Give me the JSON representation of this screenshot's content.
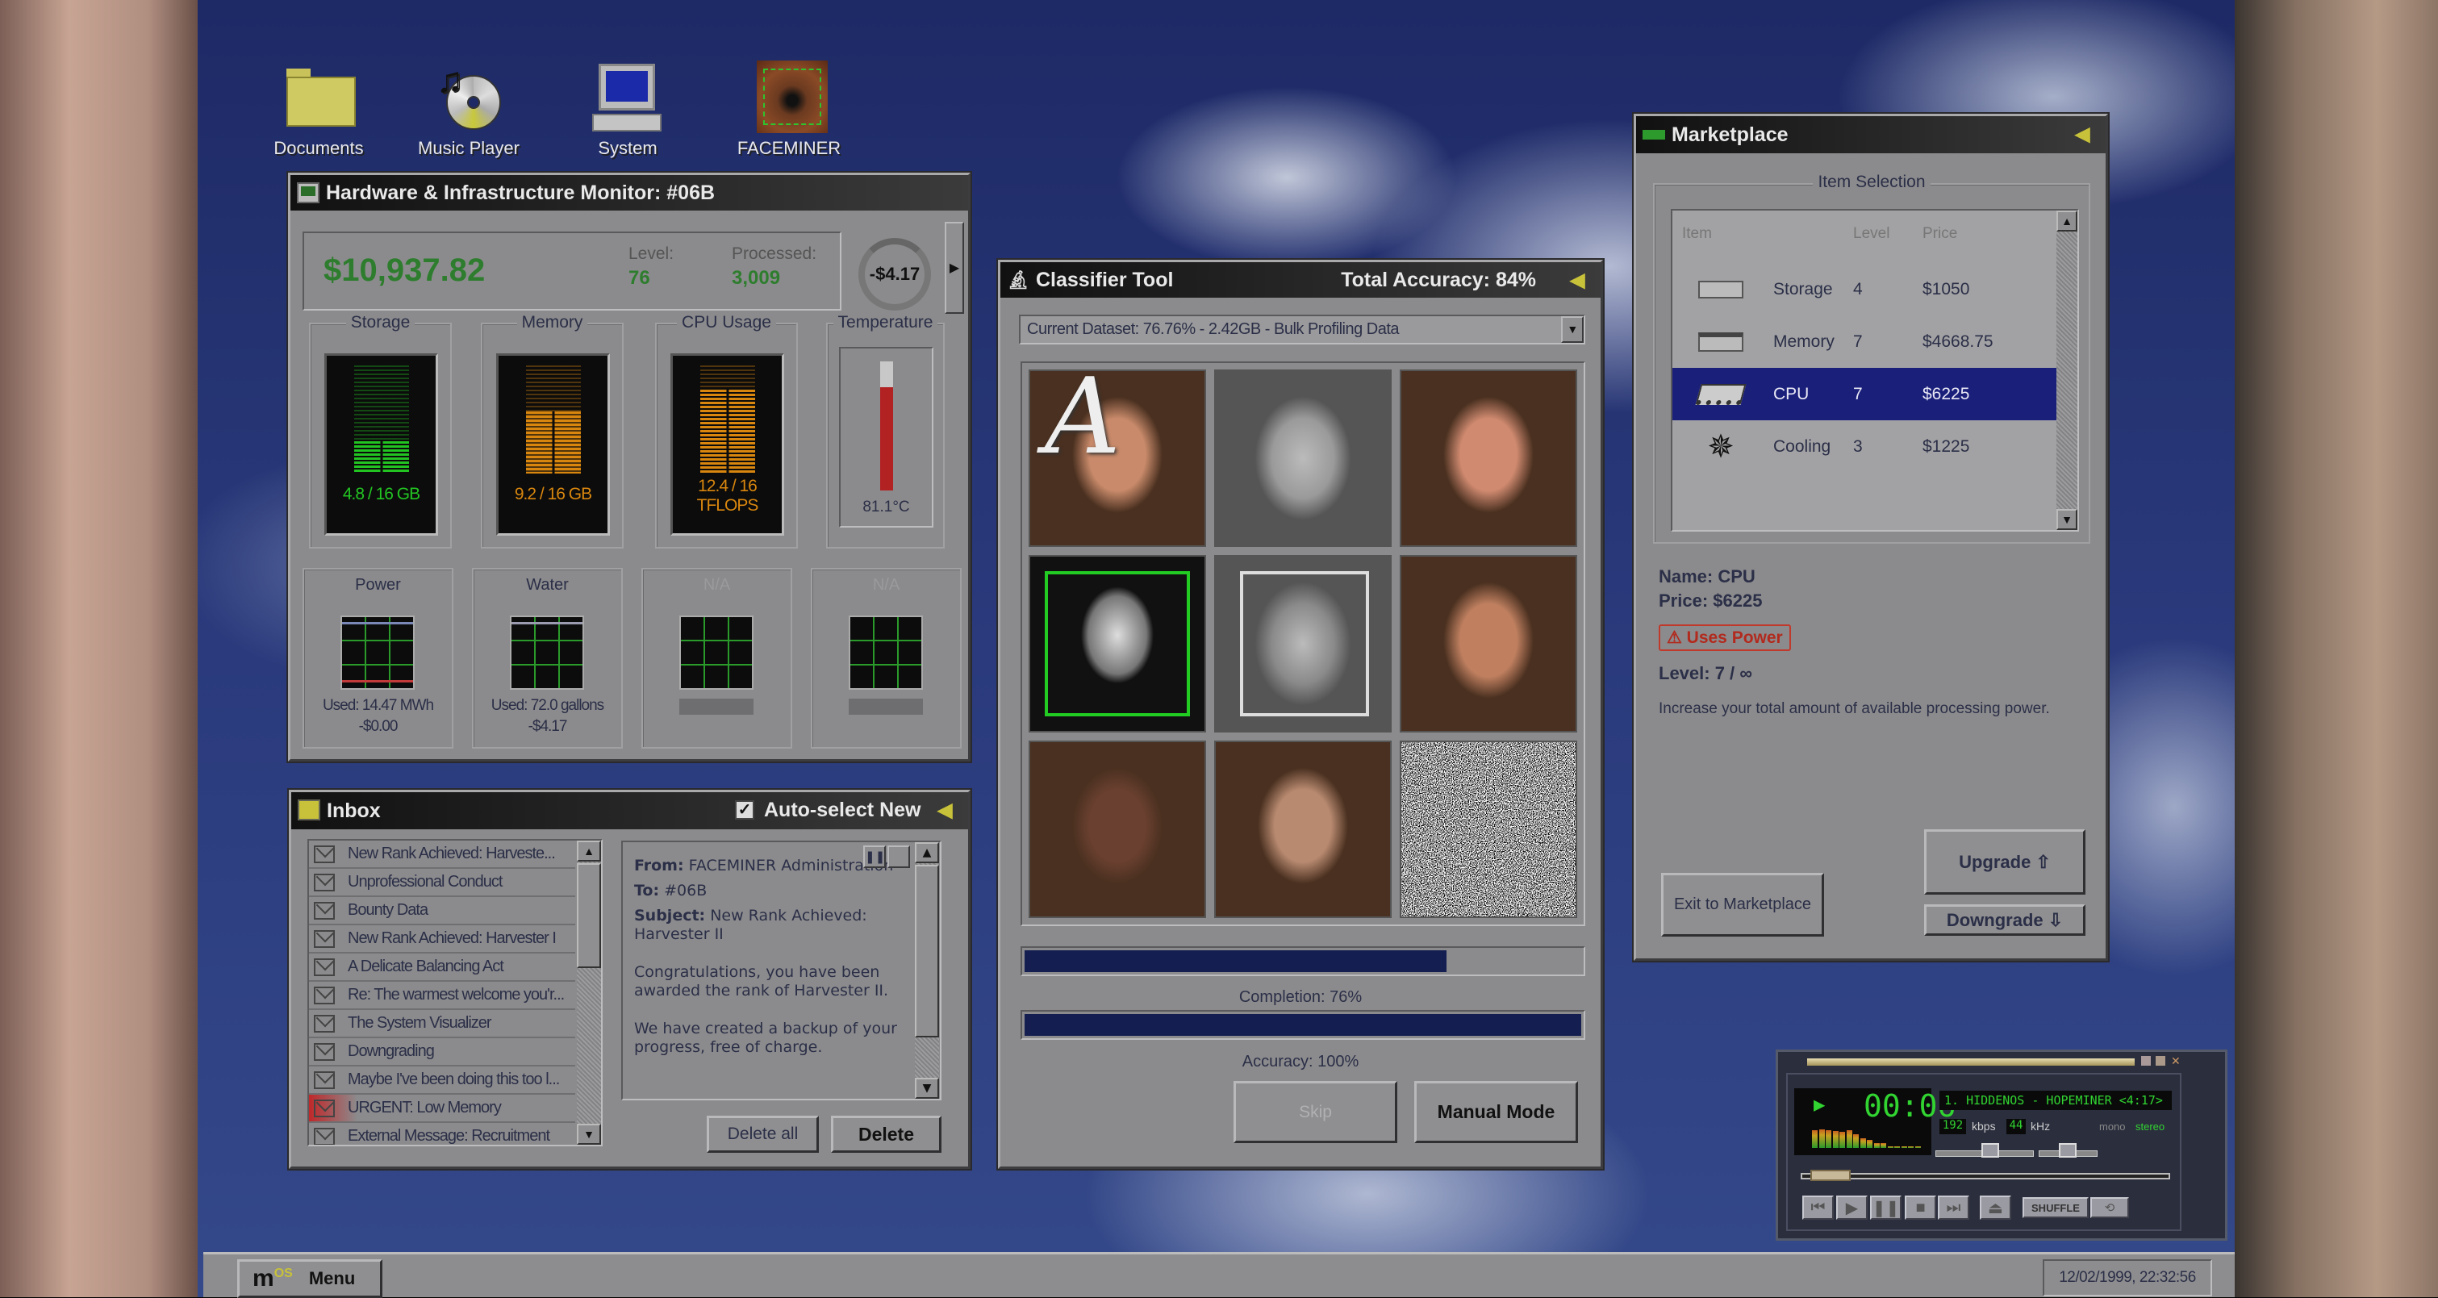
{
  "desktop_icons": [
    {
      "label": "Documents",
      "icon": "folder-icon"
    },
    {
      "label": "Music Player",
      "icon": "cd-music-icon"
    },
    {
      "label": "System",
      "icon": "computer-icon"
    },
    {
      "label": "FACEMINER",
      "icon": "eye-scan-icon"
    }
  ],
  "hardware_monitor": {
    "title": "Hardware & Infrastructure Monitor: #06B",
    "balance": "$10,937.82",
    "level_label": "Level:",
    "level": "76",
    "processed_label": "Processed:",
    "processed": "3,009",
    "rate": "-$4.17",
    "meters": [
      {
        "label": "Storage",
        "value": "4.8 / 16 GB",
        "fill": 0.3,
        "color": "#22c422"
      },
      {
        "label": "Memory",
        "value": "9.2 / 16 GB",
        "fill": 0.575,
        "color": "#d8860e"
      },
      {
        "label": "CPU Usage",
        "value": "12.4 / 16 TFLOPS",
        "fill": 0.775,
        "color": "#d8860e"
      }
    ],
    "temperature": {
      "label": "Temperature",
      "value": "81.1°C",
      "fill": 0.8,
      "color": "#b22222"
    },
    "resources": [
      {
        "label": "Power",
        "used": "Used: 14.47 MWh",
        "cost": "-$0.00"
      },
      {
        "label": "Water",
        "used": "Used: 72.0 gallons",
        "cost": "-$4.17"
      },
      {
        "label": "N/A",
        "used": "",
        "cost": ""
      },
      {
        "label": "N/A",
        "used": "",
        "cost": ""
      }
    ]
  },
  "inbox": {
    "title": "Inbox",
    "auto_select_label": "Auto-select New",
    "auto_select_checked": true,
    "messages": [
      {
        "subject": "New Rank Achieved: Harveste...",
        "urgent": false
      },
      {
        "subject": "Unprofessional Conduct",
        "urgent": false
      },
      {
        "subject": "Bounty Data",
        "urgent": false
      },
      {
        "subject": "New Rank Achieved: Harvester I",
        "urgent": false
      },
      {
        "subject": "A Delicate Balancing Act",
        "urgent": false
      },
      {
        "subject": "Re: The warmest welcome you'r...",
        "urgent": false
      },
      {
        "subject": "The System Visualizer",
        "urgent": false
      },
      {
        "subject": "Downgrading",
        "urgent": false
      },
      {
        "subject": "Maybe I've been doing this too l...",
        "urgent": false
      },
      {
        "subject": "URGENT: Low Memory",
        "urgent": true
      },
      {
        "subject": "External Message: Recruitment",
        "urgent": false
      }
    ],
    "preview": {
      "from_label": "From:",
      "from": "FACEMINER Administration",
      "to_label": "To:",
      "to": "#06B",
      "subject_label": "Subject:",
      "subject": "New Rank Achieved: Harvester II",
      "body1": "Congratulations, you have been awarded the rank of Harvester II.",
      "body2": "We have created a backup of your progress, free of charge."
    },
    "delete_all_label": "Delete all",
    "delete_label": "Delete"
  },
  "classifier": {
    "title": "Classifier Tool",
    "total_accuracy": "Total Accuracy: 84%",
    "dataset": "Current Dataset: 76.76% - 2.42GB - Bulk Profiling Data",
    "faces": [
      {
        "kind": "color",
        "tint": "#c88a6a",
        "overlay_letter": "A"
      },
      {
        "kind": "gray",
        "tint": "#9a9a9a"
      },
      {
        "kind": "color",
        "tint": "#d08a70"
      },
      {
        "kind": "bw",
        "tint": "#ffffff",
        "box": "#22cc22"
      },
      {
        "kind": "gray",
        "tint": "#8a8a8a",
        "box": "#dddddd"
      },
      {
        "kind": "color",
        "tint": "#c08060"
      },
      {
        "kind": "color",
        "tint": "#6a4030"
      },
      {
        "kind": "color",
        "tint": "#b88a70"
      },
      {
        "kind": "noise",
        "tint": "#808080"
      }
    ],
    "completion": 0.76,
    "completion_label": "Completion: 76%",
    "accuracy": 1.0,
    "accuracy_label": "Accuracy: 100%",
    "skip_label": "Skip",
    "manual_label": "Manual Mode"
  },
  "marketplace": {
    "title": "Marketplace",
    "group_label": "Item Selection",
    "columns": [
      "Item",
      "Level",
      "Price"
    ],
    "items": [
      {
        "name": "Storage",
        "level": "4",
        "price": "$1050",
        "icon": "hard-drive-icon",
        "selected": false
      },
      {
        "name": "Memory",
        "level": "7",
        "price": "$4668.75",
        "icon": "memory-module-icon",
        "selected": false
      },
      {
        "name": "CPU",
        "level": "7",
        "price": "$6225",
        "icon": "cpu-chip-icon",
        "selected": true
      },
      {
        "name": "Cooling",
        "level": "3",
        "price": "$1225",
        "icon": "snowflake-icon",
        "selected": false
      }
    ],
    "detail_name": "Name: CPU",
    "detail_price": "Price: $6225",
    "warning": "⚠ Uses Power",
    "detail_level": "Level: 7 / ∞",
    "description": "Increase your total amount of available processing power.",
    "exit_label": "Exit to Marketplace",
    "upgrade_label": "Upgrade ⇧",
    "downgrade_label": "Downgrade ⇩"
  },
  "music_player": {
    "time": "00:06",
    "track": "1. HIDDENOS - HOPEMINER <4:17>",
    "kbps": "192",
    "kbps_label": "kbps",
    "khz": "44",
    "khz_label": "kHz",
    "mono": "mono",
    "stereo": "stereo",
    "shuffle": "SHUFFLE",
    "spectrum": [
      0.8,
      0.82,
      0.78,
      0.75,
      0.72,
      0.8,
      0.6,
      0.42,
      0.35,
      0.22,
      0.2,
      0.05,
      0,
      0.05,
      0.05,
      0.05
    ]
  },
  "taskbar": {
    "menu_label": "Menu",
    "clock": "12/02/1999, 22:32:56"
  }
}
